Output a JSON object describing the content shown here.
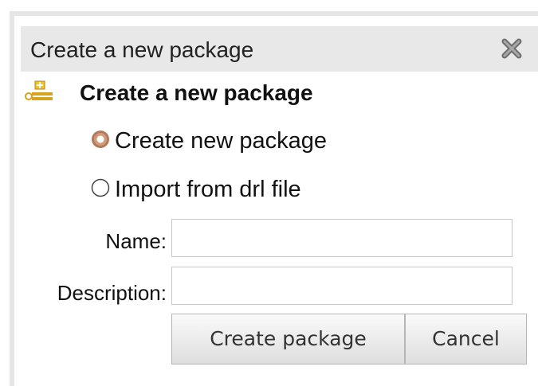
{
  "dialog": {
    "title": "Create a new package",
    "close_icon": "close-icon",
    "heading_icon": "package-icon",
    "heading": "Create a new package",
    "options": [
      {
        "label": "Create new package",
        "selected": true
      },
      {
        "label": "Import from drl file",
        "selected": false
      }
    ],
    "fields": {
      "name_label": "Name:",
      "name_value": "",
      "description_label": "Description:",
      "description_value": ""
    },
    "buttons": {
      "create_label": "Create package",
      "cancel_label": "Cancel"
    }
  },
  "colors": {
    "titlebar_bg": "#e8e8e8",
    "radio_selected": "#b37a5a"
  }
}
